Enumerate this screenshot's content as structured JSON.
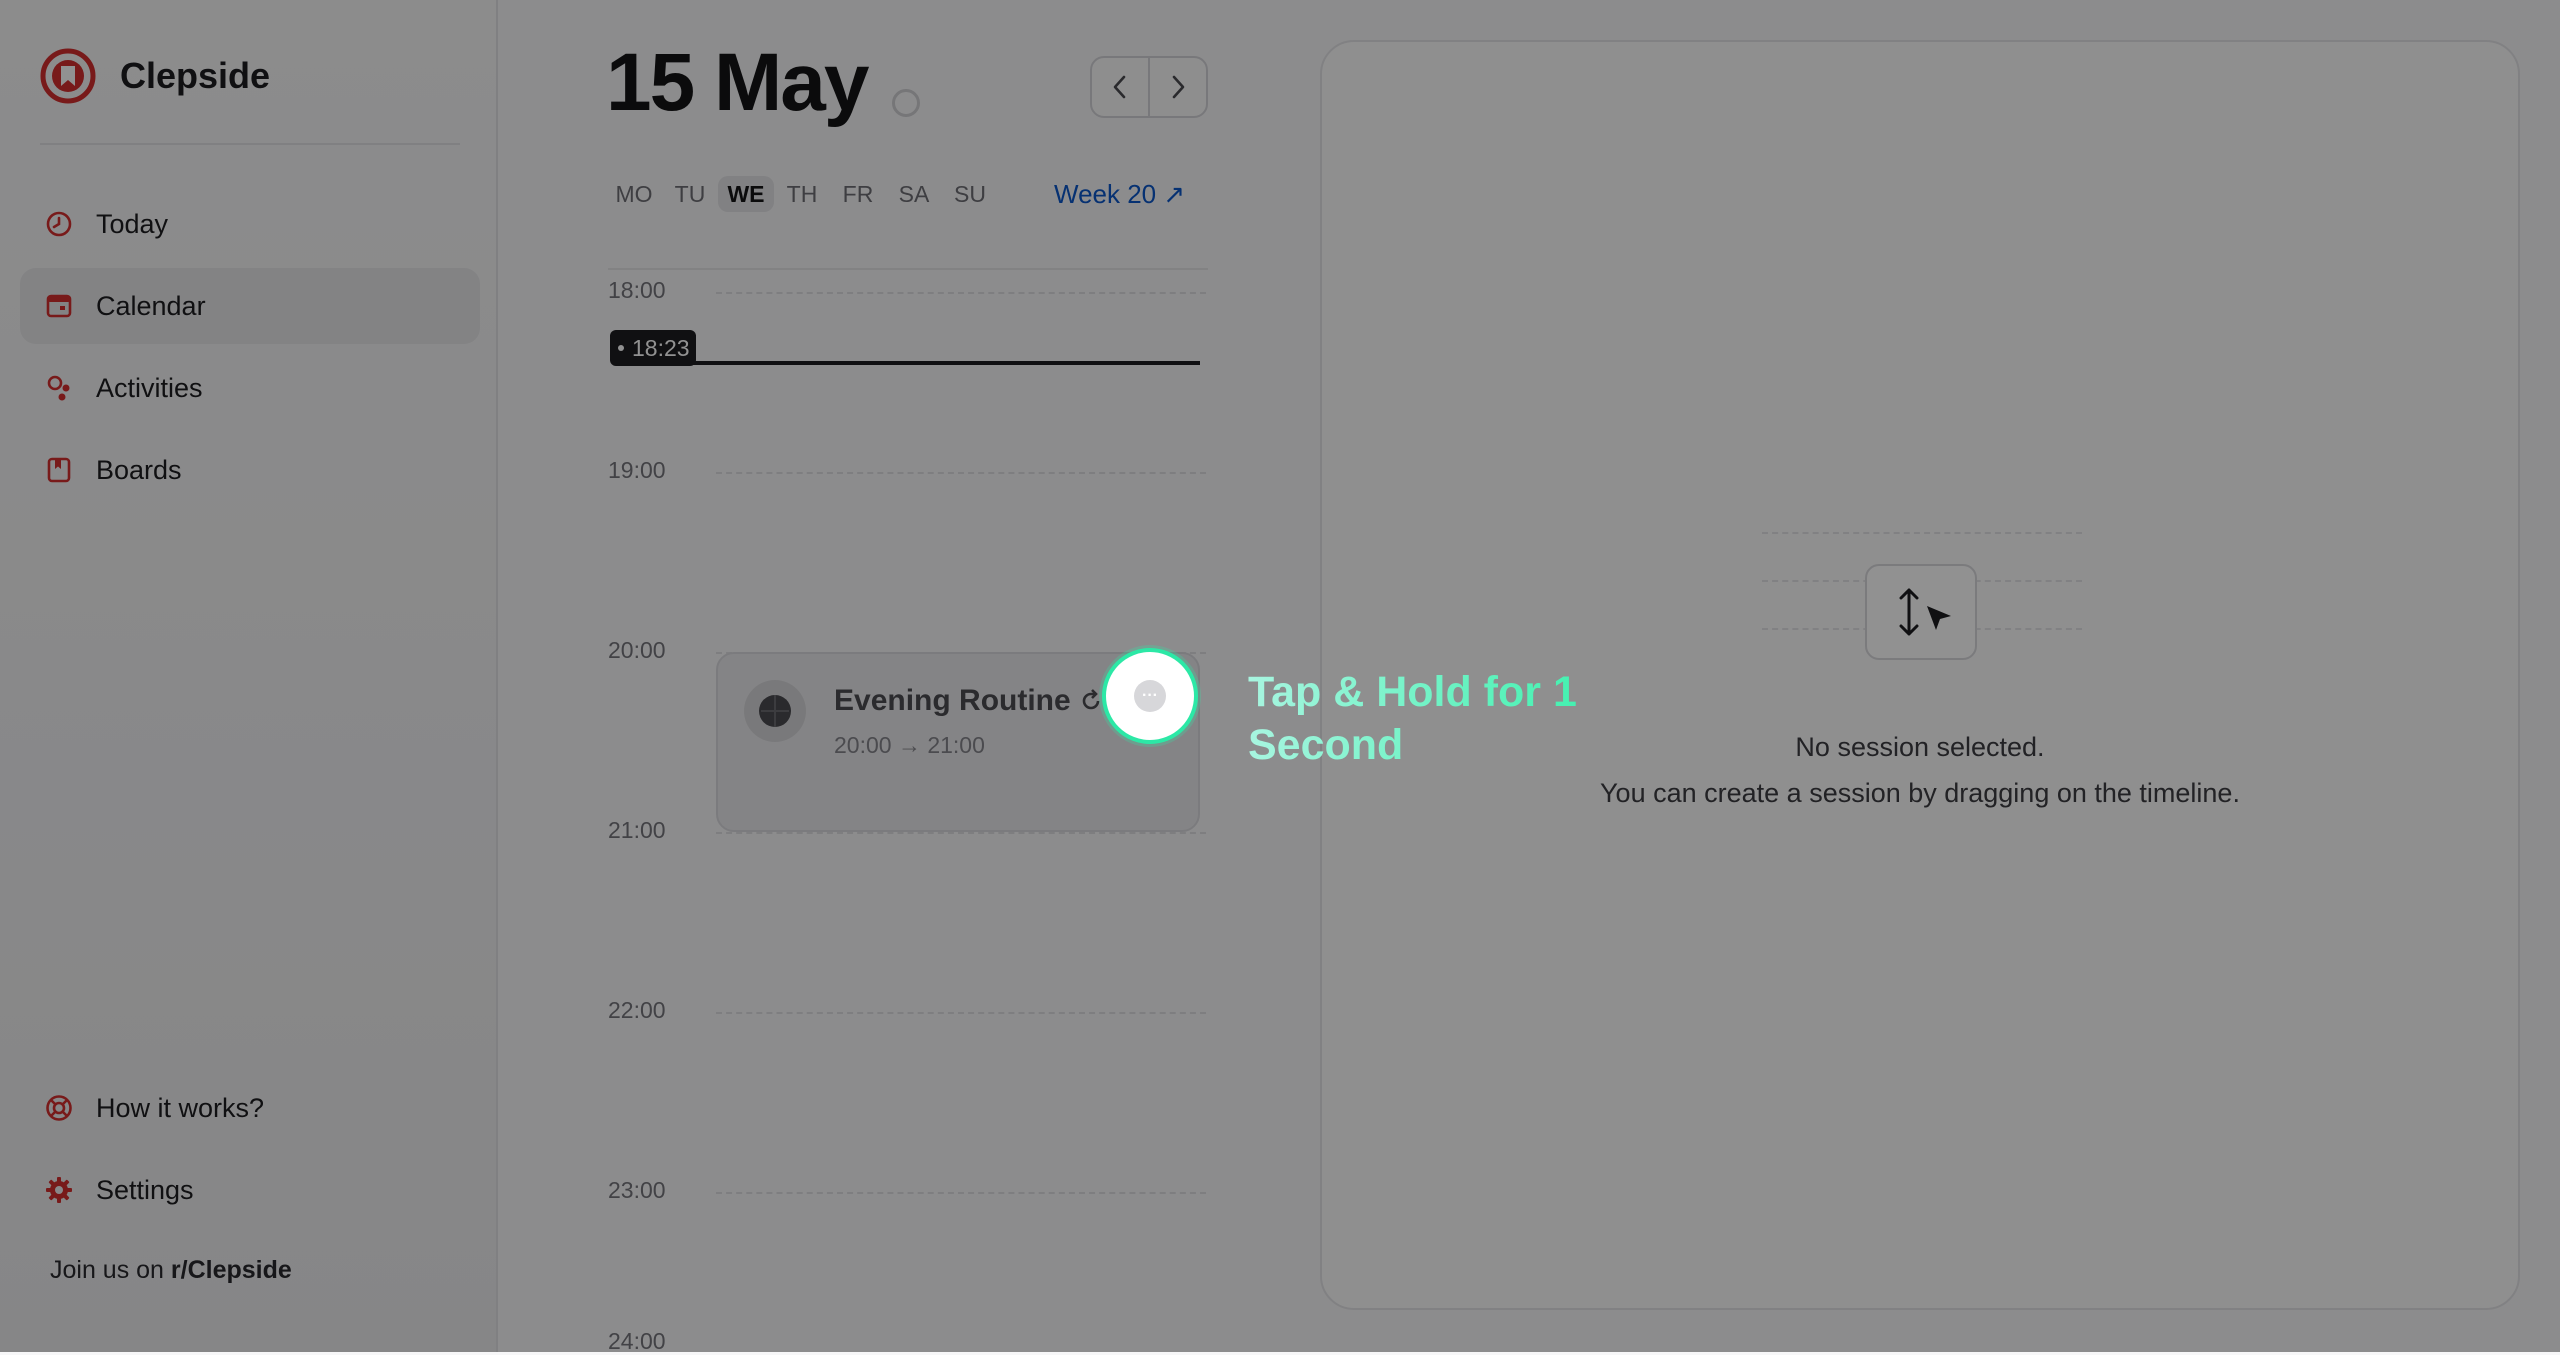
{
  "app": {
    "name": "Clepside",
    "accent": "#d32f2f"
  },
  "sidebar": {
    "items": [
      {
        "label": "Today",
        "icon": "clock-icon"
      },
      {
        "label": "Calendar",
        "icon": "calendar-icon",
        "active": true
      },
      {
        "label": "Activities",
        "icon": "activities-icon"
      },
      {
        "label": "Boards",
        "icon": "board-icon"
      }
    ],
    "bottom": [
      {
        "label": "How it works?",
        "icon": "lifebuoy-icon"
      },
      {
        "label": "Settings",
        "icon": "gear-icon"
      }
    ],
    "join_prefix": "Join us on ",
    "join_link": "r/Clepside"
  },
  "calendar": {
    "date_title": "15 May",
    "weekdays": [
      "MO",
      "TU",
      "WE",
      "TH",
      "FR",
      "SA",
      "SU"
    ],
    "active_weekday": "WE",
    "week_link": "Week 20 ↗",
    "hours": [
      "18:00",
      "19:00",
      "20:00",
      "21:00",
      "22:00",
      "23:00",
      "24:00"
    ],
    "now_time": "18:23",
    "event": {
      "title": "Evening Routine",
      "time": "20:00 → 21:00"
    }
  },
  "tutorial": {
    "hint": "Tap & Hold for 1 Second",
    "button_glyph": "···",
    "highlight_color": "#2ce8a6"
  },
  "panel": {
    "empty_title": "No session selected.",
    "empty_subtitle": "You can create a session by dragging on the timeline."
  }
}
